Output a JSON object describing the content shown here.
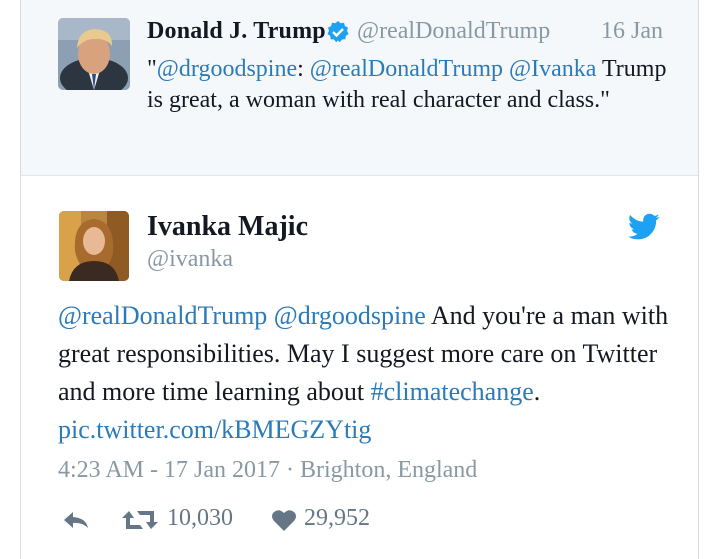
{
  "quoted": {
    "name": "Donald J. Trump",
    "handle": "@realDonaldTrump",
    "date": "16 Jan",
    "text_parts": [
      {
        "text": "\"",
        "link": false
      },
      {
        "text": "@drgoodspine",
        "link": true
      },
      {
        "text": ": ",
        "link": false
      },
      {
        "text": "@realDonaldTrump",
        "link": true
      },
      {
        "text": " ",
        "link": false
      },
      {
        "text": "@Ivanka",
        "link": true
      },
      {
        "text": " Trump is great, a woman with real character and class.\"",
        "link": false
      }
    ]
  },
  "tweet": {
    "name": "Ivanka Majic",
    "handle": "@ivanka",
    "text_parts": [
      {
        "text": "@realDonaldTrump",
        "link": true
      },
      {
        "text": " ",
        "link": false
      },
      {
        "text": "@drgoodspine",
        "link": true
      },
      {
        "text": " And you're a man with great responsibilities. May I suggest more care on Twitter and more time learning about ",
        "link": false
      },
      {
        "text": "#climatechange",
        "link": true
      },
      {
        "text": ". ",
        "link": false
      },
      {
        "text": "pic.twitter.com/kBMEGZYtig",
        "link": true
      }
    ],
    "timestamp": "4:23 AM - 17 Jan 2017 · Brighton, England",
    "retweets": "10,030",
    "likes": "29,952"
  },
  "icons": {
    "verified": "verified-badge-icon",
    "twitter": "twitter-bird-icon",
    "reply": "reply-icon",
    "retweet": "retweet-icon",
    "like": "heart-icon"
  },
  "colors": {
    "link": "#2b7bb9",
    "muted": "#8899a6",
    "twitter_blue": "#1da1f2",
    "quoted_bg": "#f5f8fa"
  }
}
